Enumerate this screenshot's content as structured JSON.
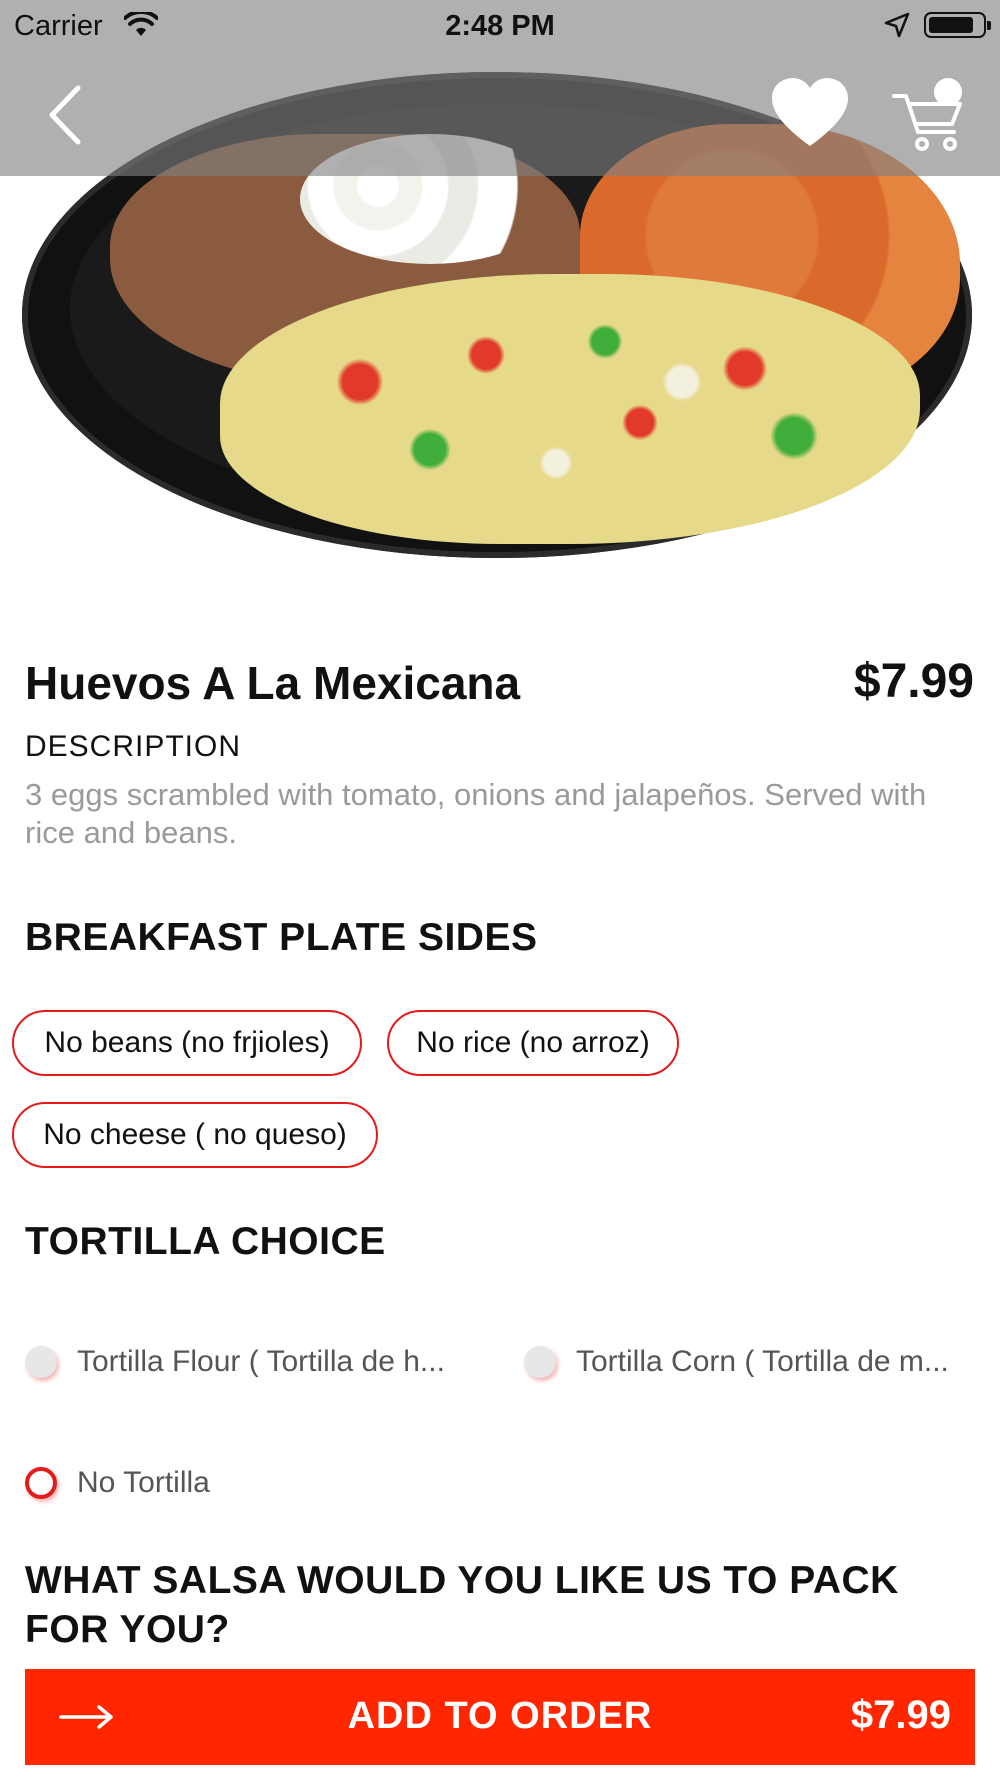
{
  "status_bar": {
    "carrier": "Carrier",
    "time": "2:48 PM"
  },
  "nav": {
    "back_icon": "chevron-left-icon",
    "favorite_icon": "heart-icon",
    "cart_icon": "cart-icon"
  },
  "item": {
    "name": "Huevos A La Mexicana",
    "price": "$7.99",
    "description_label": "DESCRIPTION",
    "description": "3 eggs scrambled with tomato, onions and jalapeños. Served with rice and beans."
  },
  "sides": {
    "title": "BREAKFAST PLATE SIDES",
    "options": [
      "No beans (no frjioles)",
      "No rice (no arroz)",
      "No cheese ( no queso)"
    ]
  },
  "tortilla": {
    "title": "TORTILLA CHOICE",
    "options": [
      {
        "label": "Tortilla Flour ( Tortilla de h...",
        "selected": false
      },
      {
        "label": "Tortilla Corn ( Tortilla de m...",
        "selected": false
      },
      {
        "label": "No Tortilla",
        "selected": true
      }
    ]
  },
  "salsa": {
    "title": "WHAT SALSA WOULD YOU LIKE US TO PACK FOR YOU?"
  },
  "add_to_order": {
    "label": "ADD TO ORDER",
    "price": "$7.99"
  },
  "colors": {
    "accent_red": "#e41b1b",
    "button_orange_red": "#ff2600",
    "muted_text": "#9a9a9a"
  }
}
